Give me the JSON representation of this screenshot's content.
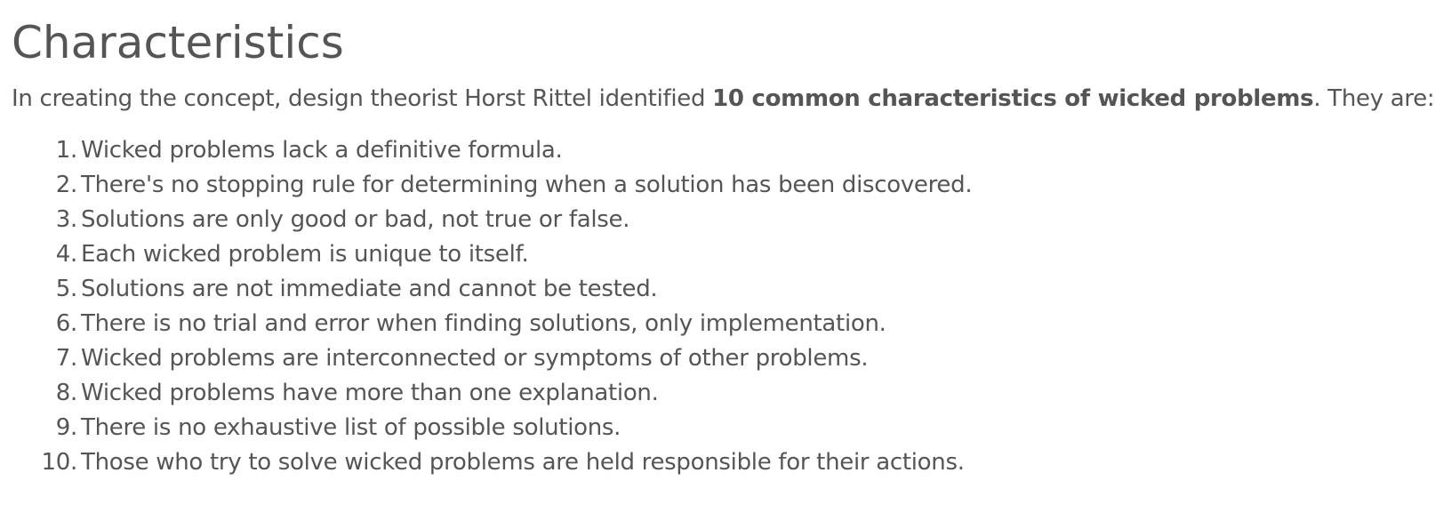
{
  "heading": "Characteristics",
  "intro": {
    "before": "In creating the concept, design theorist Horst Rittel identified ",
    "bold": "10 common characteristics of wicked problems",
    "after": ". They are:"
  },
  "items": [
    {
      "num": "1.",
      "text": "Wicked problems lack a definitive formula."
    },
    {
      "num": "2.",
      "text": "There's no stopping rule for determining when a solution has been discovered."
    },
    {
      "num": "3.",
      "text": "Solutions are only good or bad, not true or false."
    },
    {
      "num": "4.",
      "text": "Each wicked problem is unique to itself."
    },
    {
      "num": "5.",
      "text": "Solutions are not immediate and cannot be tested."
    },
    {
      "num": "6.",
      "text": "There is no trial and error when finding solutions, only implementation."
    },
    {
      "num": "7.",
      "text": "Wicked problems are interconnected or symptoms of other problems."
    },
    {
      "num": "8.",
      "text": "Wicked problems have more than one explanation."
    },
    {
      "num": "9.",
      "text": "There is no exhaustive list of possible solutions."
    },
    {
      "num": "10.",
      "text": "Those who try to solve wicked problems are held responsible for their actions."
    }
  ]
}
